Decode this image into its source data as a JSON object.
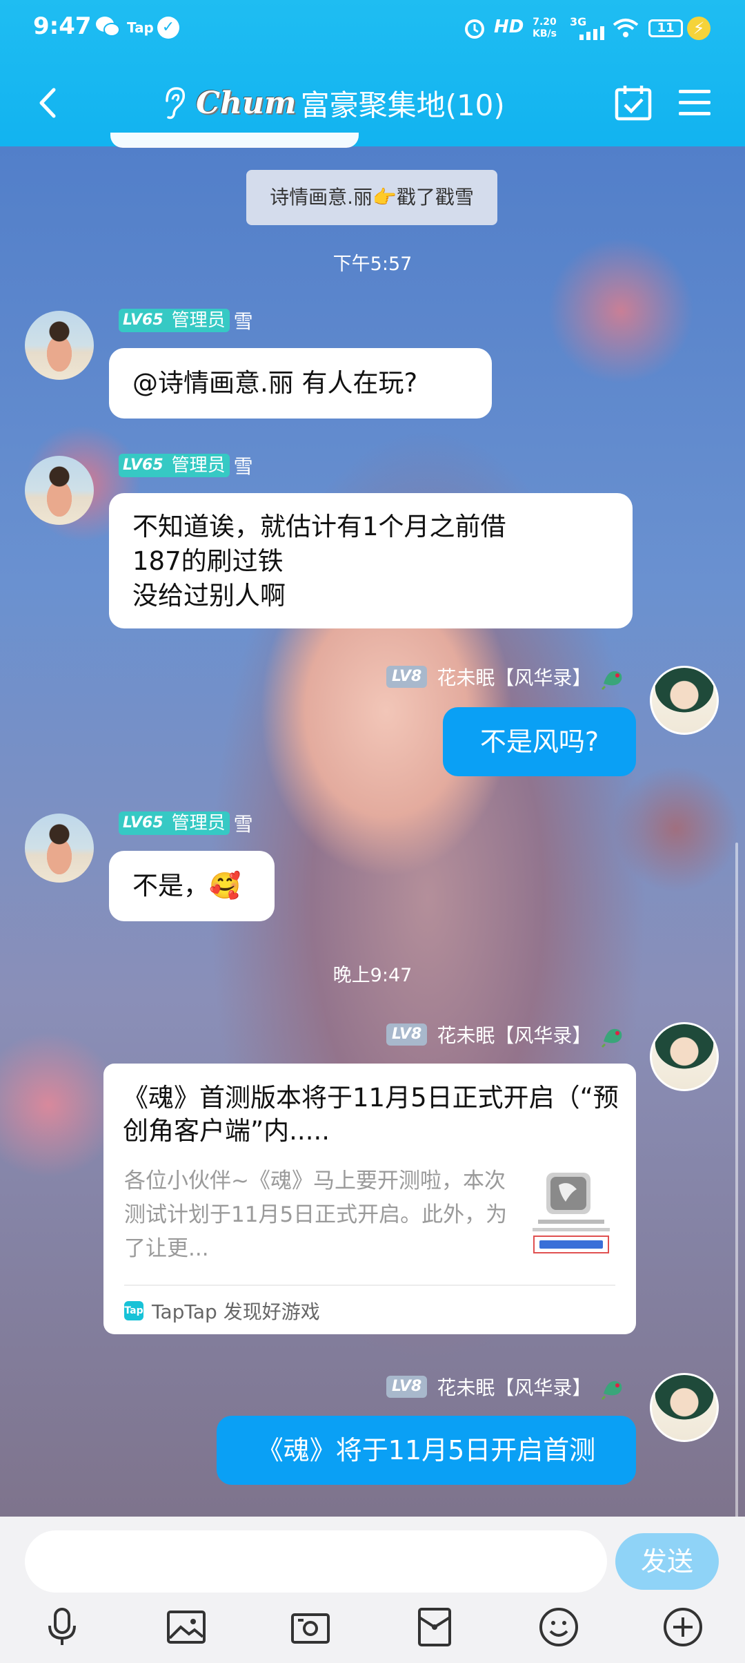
{
  "status_bar": {
    "time": "9:47",
    "tap_label": "Tap",
    "hd_label": "HD",
    "speed": "7.20",
    "speed_unit": "KB/s",
    "network": "3G",
    "battery": "11"
  },
  "header": {
    "logo_text": "Chum",
    "title": "富豪聚集地(10)"
  },
  "messages": {
    "system_notice": "诗情画意.丽👉戳了戳雪",
    "timestamp_1": "下午5:57",
    "timestamp_2": "晚上9:47",
    "admin_level": "LV65",
    "admin_role": "管理员",
    "admin_name": "雪",
    "user_level": "LV8",
    "user_name": "花未眠【风华录】",
    "msg_1": "@诗情画意.丽 有人在玩?",
    "msg_2_line1": "不知道诶，就估计有1个月之前借",
    "msg_2_line2": "187的刷过铁",
    "msg_2_line3": "没给过别人啊",
    "msg_3": "不是风吗?",
    "msg_4": "不是，🥰",
    "card": {
      "title": "《魂》首测版本将于11月5日正式开启（“预创角客户端”内.....",
      "desc": "各位小伙伴~《魂》马上要开测啦，本次测试计划于11月5日正式开启。此外，为了让更...",
      "source": "TapTap 发现好游戏",
      "source_icon": "Tap"
    },
    "msg_6": "《魂》将于11月5日开启首测"
  },
  "composer": {
    "send_label": "发送"
  },
  "colors": {
    "header_bg": "#12b3f0",
    "self_bubble": "#0aa0f5",
    "admin_badge": "#36c9c4"
  }
}
